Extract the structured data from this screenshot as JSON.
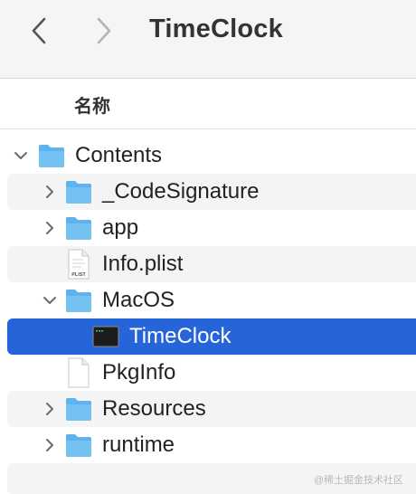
{
  "window": {
    "title": "TimeClock",
    "back_icon": "chevron-left-icon",
    "forward_icon": "chevron-right-icon"
  },
  "columns": {
    "name": "名称"
  },
  "rows": [
    {
      "label": "Contents",
      "icon": "folder-icon",
      "expanded": true
    },
    {
      "label": "_CodeSignature",
      "icon": "folder-icon",
      "expanded": false
    },
    {
      "label": "app",
      "icon": "folder-icon",
      "expanded": false
    },
    {
      "label": "Info.plist",
      "icon": "plist-file-icon",
      "badge": "PLIST"
    },
    {
      "label": "MacOS",
      "icon": "folder-icon",
      "expanded": true
    },
    {
      "label": "TimeClock",
      "icon": "terminal-executable-icon",
      "selected": true
    },
    {
      "label": "PkgInfo",
      "icon": "document-icon"
    },
    {
      "label": "Resources",
      "icon": "folder-icon",
      "expanded": false
    },
    {
      "label": "runtime",
      "icon": "folder-icon",
      "expanded": false
    }
  ],
  "watermark": "@稀土掘金技术社区",
  "colors": {
    "selection": "#2665d9",
    "folder": "#5bb4ef",
    "alt_row": "#f4f4f5"
  }
}
